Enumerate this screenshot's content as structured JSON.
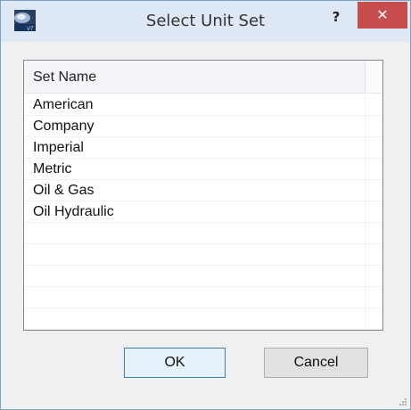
{
  "window": {
    "title": "Select Unit Set",
    "help_label": "?",
    "close_label": "✕",
    "icon": "vt-app-icon"
  },
  "list": {
    "column_header": "Set Name",
    "items": [
      {
        "name": "American"
      },
      {
        "name": "Company"
      },
      {
        "name": "Imperial"
      },
      {
        "name": "Metric"
      },
      {
        "name": "Oil & Gas"
      },
      {
        "name": "Oil Hydraulic"
      }
    ]
  },
  "buttons": {
    "ok_label": "OK",
    "cancel_label": "Cancel"
  },
  "colors": {
    "titlebar": "#dfe9f5",
    "close_button": "#c74c4c",
    "ok_button_border": "#3c7fb1"
  }
}
